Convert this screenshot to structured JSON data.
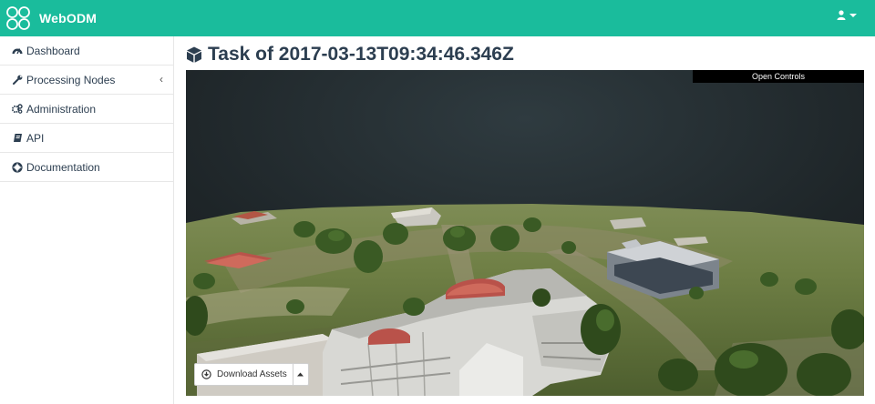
{
  "app": {
    "name": "WebODM"
  },
  "header": {
    "user_icon": "user-icon",
    "dropdown_icon": "caret-down-icon"
  },
  "sidebar": {
    "items": [
      {
        "label": "Dashboard",
        "icon": "tachometer-icon"
      },
      {
        "label": "Processing Nodes",
        "icon": "wrench-icon",
        "caret": "‹"
      },
      {
        "label": "Administration",
        "icon": "gears-icon"
      },
      {
        "label": "API",
        "icon": "book-icon"
      },
      {
        "label": "Documentation",
        "icon": "life-ring-icon"
      }
    ]
  },
  "page": {
    "title": "Task of 2017-03-13T09:34:46.346Z",
    "title_icon": "cube-icon"
  },
  "viewer": {
    "open_controls_label": "Open Controls",
    "download_label": "Download Assets",
    "download_icon": "download-icon",
    "dropdown_icon": "caret-up-icon"
  },
  "colors": {
    "header": "#1abc9c",
    "text": "#2c3e50",
    "sky": "#1d2326"
  }
}
